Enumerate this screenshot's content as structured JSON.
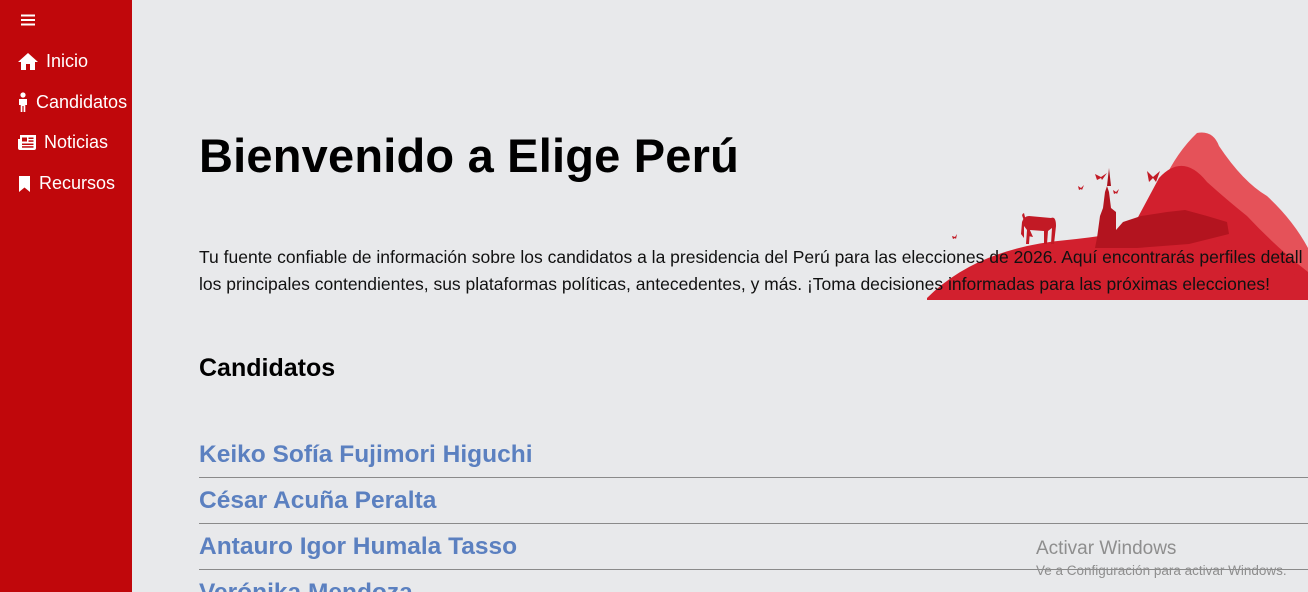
{
  "sidebar": {
    "menu_icon": "hamburger-icon",
    "items": [
      {
        "label": "Inicio",
        "icon": "home-icon"
      },
      {
        "label": "Candidatos",
        "icon": "person-icon"
      },
      {
        "label": "Noticias",
        "icon": "newspaper-icon"
      },
      {
        "label": "Recursos",
        "icon": "bookmark-icon"
      }
    ]
  },
  "main": {
    "title": "Bienvenido a Elige Perú",
    "intro_line1": "Tu fuente confiable de información sobre los candidatos a la presidencia del Perú para las elecciones de 2026. Aquí encontrarás perfiles detall",
    "intro_line2": "los principales contendientes, sus plataformas políticas, antecedentes, y más. ¡Toma decisiones informadas para las próximas elecciones!",
    "section_title": "Candidatos",
    "candidates": [
      "Keiko Sofía Fujimori Higuchi",
      "César Acuña Peralta",
      "Antauro Igor Humala Tasso",
      "Verónika Mendoza"
    ]
  },
  "watermark": {
    "title": "Activar Windows",
    "subtitle": "Ve a Configuración para activar Windows."
  },
  "colors": {
    "sidebar": "#c0070b",
    "background": "#e8e9eb",
    "link": "#5b80c0",
    "accent_red": "#d2202e"
  }
}
